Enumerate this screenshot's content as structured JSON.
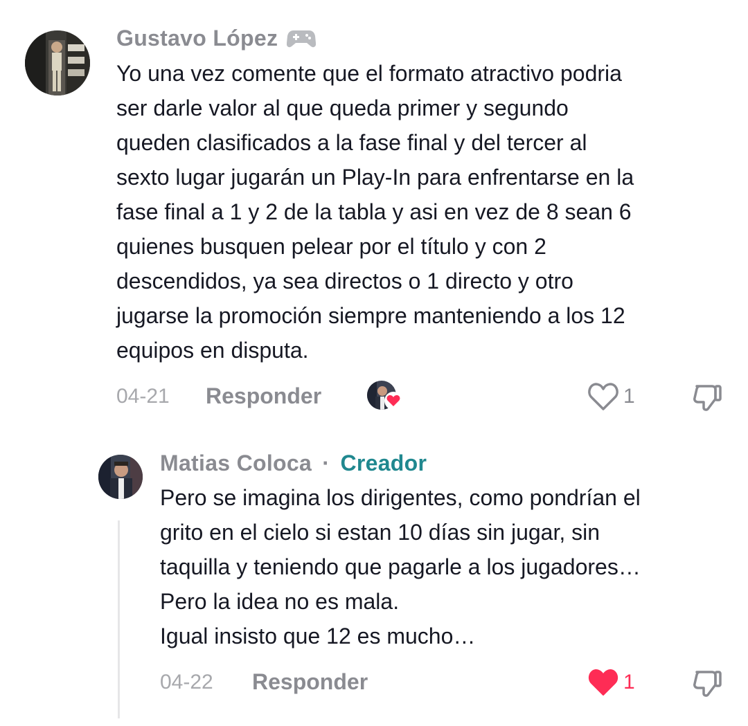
{
  "comment1": {
    "username": "Gustavo López",
    "badge_icon": "gamepad-icon",
    "lines": [
      "Yo una vez comente que el formato atractivo podria",
      "ser darle valor al que queda primer y segundo",
      "queden clasificados a la fase final y del tercer al",
      "sexto lugar jugarán un Play-In para enfrentarse en la",
      "fase final a 1 y 2 de la tabla y asi en vez de 8 sean 6",
      "quienes busquen pelear por el título y con 2",
      "descendidos, ya sea directos o 1 directo y otro",
      "jugarse la promoción siempre manteniendo a los 12",
      "equipos en disputa."
    ],
    "date": "04-21",
    "reply_label": "Responder",
    "like_count": "1",
    "liked_by_creator": true
  },
  "comment2": {
    "username": "Matias Coloca",
    "separator": "·",
    "role": "Creador",
    "lines": [
      "Pero se imagina los dirigentes, como pondrían el",
      "grito en el cielo si estan 10 días sin jugar, sin",
      "taquilla y teniendo que pagarle a los jugadores…",
      "Pero la idea no es mala.",
      "Igual insisto que 12 es mucho…"
    ],
    "date": "04-22",
    "reply_label": "Responder",
    "like_count": "1",
    "liked": true
  },
  "colors": {
    "accent_red": "#fe2c55",
    "creator_teal": "#20888f",
    "muted_gray": "#8a8b91"
  }
}
